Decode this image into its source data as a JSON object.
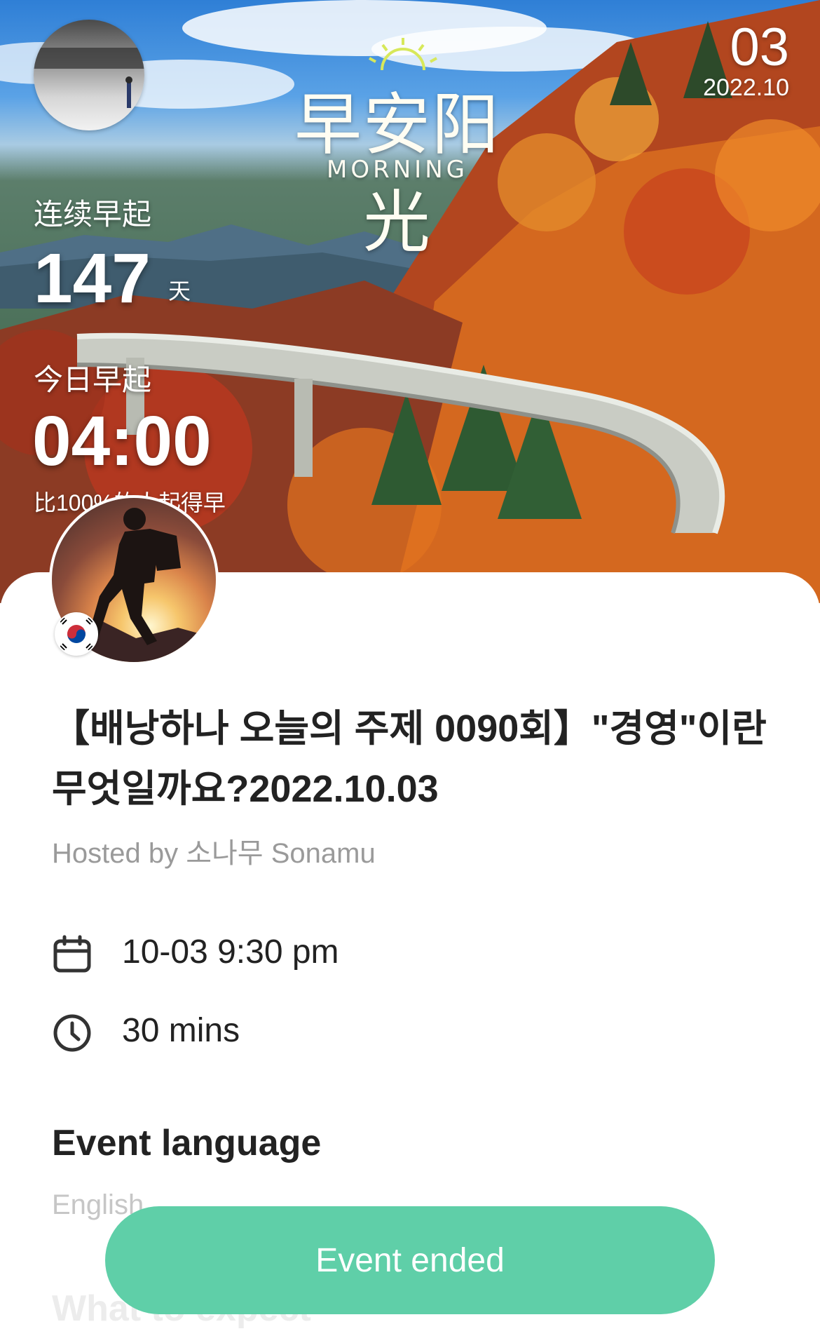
{
  "hero": {
    "logo_cn": "早安阳光",
    "logo_en": "MORNING",
    "date_day": "03",
    "date_year_month": "2022.10",
    "streak_label": "连续早起",
    "streak_days": "147",
    "streak_unit": "天",
    "today_label": "今日早起",
    "wake_time": "04:00",
    "rank_text": "比100%的人起得早"
  },
  "event": {
    "title": "【배낭하나 오늘의 주제 0090회】\"경영\"이란 무엇일까요?2022.10.03",
    "hosted_by": "Hosted by 소나무 Sonamu",
    "datetime": "10-03 9:30 pm",
    "duration": "30 mins",
    "language_heading": "Event language",
    "language_value": "English",
    "next_heading": "What to expect",
    "host_country": "KR",
    "button_label": "Event ended"
  },
  "icons": {
    "calendar": "calendar-icon",
    "clock": "clock-icon",
    "flag": "south-korea-flag-icon"
  },
  "colors": {
    "accent": "#5fcfa8",
    "title_text": "#222222",
    "muted_text": "#9a9a9a"
  }
}
